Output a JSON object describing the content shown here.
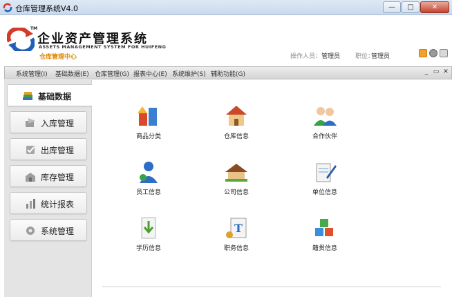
{
  "window": {
    "title": "仓库管理系统V4.0",
    "minimize": "—",
    "maximize": "□",
    "close": "✕"
  },
  "header": {
    "tm": "TM",
    "brand_title": "企业资产管理系统",
    "brand_subtitle": "ASSETS MANAGEMENT SYSTEM FOR HUIFENG",
    "brand_center": "仓库管理中心",
    "operator_label": "操作人员：",
    "operator_value": "管理员",
    "role_label": "职位：",
    "role_value": "管理员"
  },
  "menu": {
    "items": [
      "系统管理(I)",
      "基础数据(E)",
      "仓库管理(G)",
      "报表中心(E)",
      "系统维护(S)",
      "辅助功能(G)"
    ],
    "mdi": [
      "_",
      "▭",
      "✕"
    ]
  },
  "nav": {
    "items": [
      {
        "label": "基础数据",
        "icon": "books-icon",
        "active": true
      },
      {
        "label": "入库管理",
        "icon": "stock-in-icon",
        "active": false
      },
      {
        "label": "出库管理",
        "icon": "stock-out-icon",
        "active": false
      },
      {
        "label": "库存管理",
        "icon": "inventory-icon",
        "active": false
      },
      {
        "label": "统计报表",
        "icon": "report-icon",
        "active": false
      },
      {
        "label": "系统管理",
        "icon": "system-icon",
        "active": false
      }
    ]
  },
  "tiles": [
    {
      "label": "商品分类",
      "icon": "product-category-icon"
    },
    {
      "label": "仓库信息",
      "icon": "warehouse-icon"
    },
    {
      "label": "合作伙伴",
      "icon": "partners-icon"
    },
    {
      "label": "员工信息",
      "icon": "employee-icon"
    },
    {
      "label": "公司信息",
      "icon": "company-icon"
    },
    {
      "label": "单位信息",
      "icon": "unit-icon"
    },
    {
      "label": "学历信息",
      "icon": "education-icon"
    },
    {
      "label": "职务信息",
      "icon": "position-icon"
    },
    {
      "label": "籍贯信息",
      "icon": "native-place-icon"
    }
  ],
  "colors": {
    "accent": "#e08a00",
    "titlebar": "#c9d9ec",
    "panel": "#e4e4e4"
  }
}
